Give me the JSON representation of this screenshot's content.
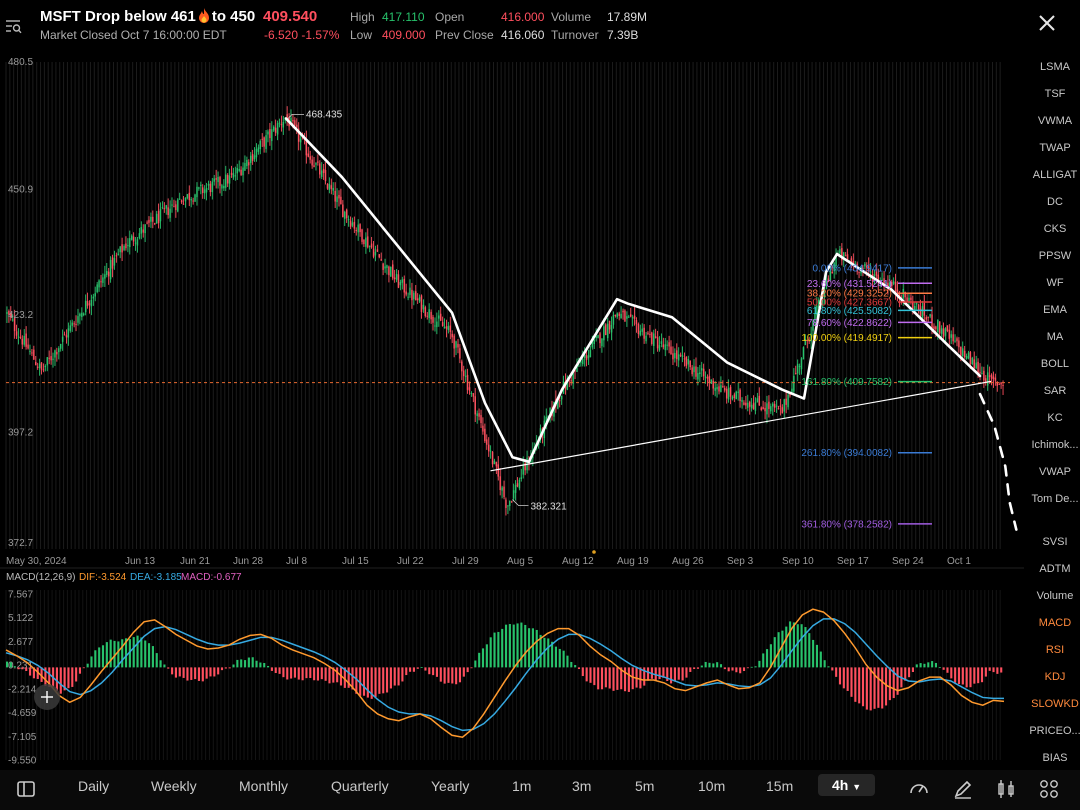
{
  "header": {
    "symbol_title": "MSFT  Drop below 461",
    "title_suffix": "to 450",
    "last_price": "409.540",
    "market_status": "Market Closed Oct 7 16:00:00 EDT",
    "change": "-6.520  -1.57%",
    "stats": {
      "high_label": "High",
      "high": "417.110",
      "low_label": "Low",
      "low": "409.000",
      "open_label": "Open",
      "open": "416.000",
      "prev_close_label": "Prev Close",
      "prev_close": "416.060",
      "volume_label": "Volume",
      "volume": "17.89M",
      "turnover_label": "Turnover",
      "turnover": "7.39B"
    },
    "icons": {
      "left": "search-list-icon",
      "close": "close-icon"
    }
  },
  "colors": {
    "up": "#27c26b",
    "down": "#ff4f5e",
    "dif": "#ff9a2e",
    "dea": "#36a9e1",
    "active": "#ff8a3d"
  },
  "indicators": [
    "LSMA",
    "TSF",
    "VWMA",
    "TWAP",
    "ALLIGAT",
    "DC",
    "CKS",
    "PPSW",
    "WF",
    "EMA",
    "MA",
    "BOLL",
    "SAR",
    "KC",
    "Ichimok...",
    "VWAP",
    "Tom De...",
    "SVSI",
    "ADTM",
    "Volume",
    "MACD",
    "RSI",
    "KDJ",
    "SLOWKD",
    "PRICEO...",
    "BIAS"
  ],
  "active_indicators": [
    "MACD",
    "RSI",
    "KDJ",
    "SLOWKD"
  ],
  "timeframes": [
    "Daily",
    "Weekly",
    "Monthly",
    "Quarterly",
    "Yearly",
    "1m",
    "3m",
    "5m",
    "10m",
    "15m"
  ],
  "selected_timeframe": "4h",
  "bottom_icons": [
    "sidebar-toggle-icon",
    "speedometer-icon",
    "pen-icon",
    "candle-settings-icon",
    "grid-icon"
  ],
  "chart_data": [
    {
      "type": "candlestick",
      "interval": "4h",
      "y_ticks": [
        "480.5",
        "450.9",
        "423.2",
        "397.2",
        "372.7"
      ],
      "ylim": [
        372.7,
        480.5
      ],
      "x_ticks": [
        "May 30, 2024",
        "Jun 13",
        "Jun 21",
        "Jun 28",
        "Jul 8",
        "Jul 15",
        "Jul 22",
        "Jul 29",
        "Aug 5",
        "Aug 12",
        "Aug 19",
        "Aug 26",
        "Sep 3",
        "Sep 10",
        "Sep 17",
        "Sep 24",
        "Oct 1"
      ],
      "price_path": [
        {
          "x": "May 30, 2024",
          "y": 425
        },
        {
          "x": "Jun 4",
          "y": 412
        },
        {
          "x": "Jun 13",
          "y": 440
        },
        {
          "x": "Jun 21",
          "y": 450
        },
        {
          "x": "Jun 28",
          "y": 455
        },
        {
          "x": "Jul 8",
          "y": 468.435
        },
        {
          "x": "Jul 15",
          "y": 448
        },
        {
          "x": "Jul 22",
          "y": 432
        },
        {
          "x": "Jul 29",
          "y": 420
        },
        {
          "x": "Aug 5",
          "y": 382.321
        },
        {
          "x": "Aug 12",
          "y": 408
        },
        {
          "x": "Aug 19",
          "y": 425
        },
        {
          "x": "Aug 26",
          "y": 416
        },
        {
          "x": "Sep 3",
          "y": 407
        },
        {
          "x": "Sep 10",
          "y": 403
        },
        {
          "x": "Sep 17",
          "y": 438
        },
        {
          "x": "Sep 24",
          "y": 431
        },
        {
          "x": "Oct 1",
          "y": 420
        },
        {
          "x": "Oct 7",
          "y": 409.54
        }
      ],
      "annotations": {
        "high_label": "468.435",
        "low_label": "382.321"
      },
      "current_price_line": 409.54,
      "fibonacci": [
        {
          "label": "0.00% (434.9417)",
          "value": 434.9417,
          "color": "#3a7bd5"
        },
        {
          "label": "23.60% (431.5241)",
          "value": 431.5241,
          "color": "#c06cf0"
        },
        {
          "label": "38.20% (429.3252)",
          "value": 429.3252,
          "color": "#ff7a45"
        },
        {
          "label": "50.00% (427.3667)",
          "value": 427.3667,
          "color": "#e03a3a"
        },
        {
          "label": "61.80% (425.5082)",
          "value": 425.5082,
          "color": "#31c2d6"
        },
        {
          "label": "78.60% (422.8622)",
          "value": 422.8622,
          "color": "#c06cf0"
        },
        {
          "label": "100.00% (419.4917)",
          "value": 419.4917,
          "color": "#f0d010"
        },
        {
          "label": "161.80% (409.7582)",
          "value": 409.7582,
          "color": "#27c26b"
        },
        {
          "label": "261.80% (394.0082)",
          "value": 394.0082,
          "color": "#3a7bd5"
        },
        {
          "label": "361.80% (378.2582)",
          "value": 378.2582,
          "color": "#a05ce0"
        }
      ]
    },
    {
      "type": "macd",
      "header": "MACD(12,26,9)",
      "dif_label": "DIF:-3.524",
      "dea_label": "DEA:-3.185",
      "macd_label": "MACD:-0.677",
      "y_ticks": [
        "7.567",
        "5.122",
        "2.677",
        "0.231",
        "-2.214",
        "-4.659",
        "-7.105",
        "-9.550"
      ],
      "ylim": [
        -9.55,
        7.567
      ],
      "dif": [
        1.8,
        1.2,
        0.5,
        -0.5,
        -1.6,
        -2.9,
        -3.6,
        -3.1,
        -1.8,
        -0.4,
        0.9,
        2.2,
        3.6,
        4.7,
        4.9,
        4.2,
        3.4,
        2.8,
        2.2,
        1.9,
        2.0,
        2.3,
        2.9,
        3.3,
        3.4,
        3.0,
        2.3,
        1.8,
        1.4,
        1.0,
        0.4,
        -0.3,
        -1.3,
        -2.5,
        -3.9,
        -4.8,
        -5.3,
        -5.5,
        -5.1,
        -4.8,
        -5.3,
        -6.2,
        -7.0,
        -7.2,
        -6.3,
        -4.8,
        -3.1,
        -1.4,
        0.2,
        1.6,
        2.7,
        3.5,
        4.0,
        4.0,
        3.3,
        2.2,
        1.3,
        0.6,
        -0.3,
        -1.0,
        -1.3,
        -1.3,
        -1.6,
        -2.2,
        -2.4,
        -2.0,
        -1.6,
        -1.3,
        -1.8,
        -2.2,
        -2.1,
        -1.6,
        0.0,
        2.0,
        4.0,
        5.4,
        6.0,
        5.7,
        4.8,
        3.5,
        2.0,
        0.3,
        -1.0,
        -1.9,
        -2.4,
        -2.1,
        -1.4,
        -1.0,
        -1.0,
        -1.8,
        -2.9,
        -3.6,
        -3.9,
        -3.4,
        -3.5
      ],
      "dea": [
        1.5,
        1.2,
        0.8,
        0.2,
        -0.6,
        -1.6,
        -2.5,
        -2.8,
        -2.4,
        -1.6,
        -0.5,
        0.8,
        2.0,
        3.2,
        4.0,
        4.2,
        3.9,
        3.4,
        2.9,
        2.5,
        2.3,
        2.3,
        2.5,
        2.8,
        3.1,
        3.1,
        2.8,
        2.4,
        2.0,
        1.6,
        1.1,
        0.5,
        -0.3,
        -1.2,
        -2.3,
        -3.3,
        -4.1,
        -4.6,
        -4.8,
        -4.8,
        -5.0,
        -5.5,
        -6.1,
        -6.5,
        -6.4,
        -5.8,
        -4.8,
        -3.5,
        -2.1,
        -0.6,
        0.8,
        2.0,
        2.9,
        3.4,
        3.4,
        3.0,
        2.4,
        1.7,
        0.9,
        0.2,
        -0.3,
        -0.7,
        -1.0,
        -1.4,
        -1.8,
        -1.9,
        -1.8,
        -1.6,
        -1.7,
        -1.9,
        -2.0,
        -1.8,
        -1.1,
        0.2,
        1.7,
        3.1,
        4.3,
        5.0,
        5.0,
        4.5,
        3.6,
        2.4,
        1.2,
        0.1,
        -0.9,
        -1.4,
        -1.5,
        -1.3,
        -1.2,
        -1.4,
        -2.0,
        -2.6,
        -3.1,
        -3.2,
        -3.2
      ]
    }
  ]
}
